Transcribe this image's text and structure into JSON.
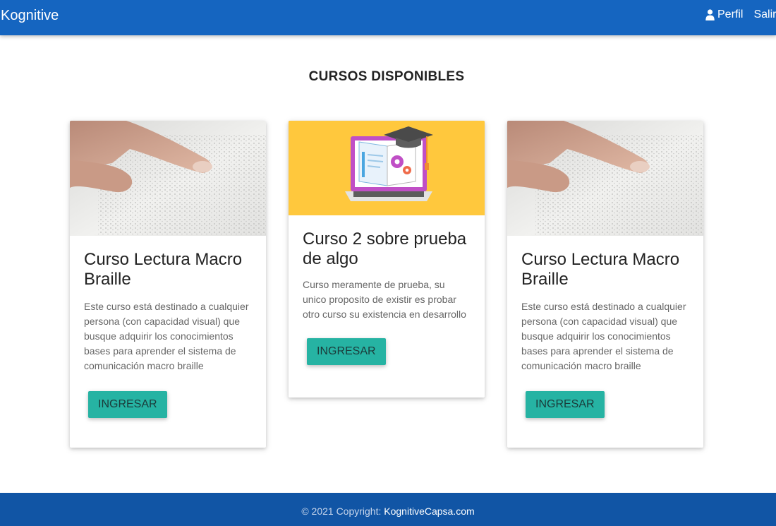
{
  "navbar": {
    "brand": "Kognitive",
    "perfil_label": "Perfil",
    "salir_label": "Salir",
    "user_icon": "user-icon"
  },
  "page": {
    "title": "CURSOS DISPONIBLES"
  },
  "courses": [
    {
      "image": "braille-reading-photo",
      "title": "Curso Lectura Macro Braille",
      "description": "Este curso está destinado a cualquier persona (con capacidad visual) que busque adquirir los conocimientos bases para aprender el sistema de comunicación macro braille",
      "button_label": "INGRESAR"
    },
    {
      "image": "laptop-book-graduation-illustration",
      "title": "Curso 2 sobre prueba de algo",
      "description": "Curso meramente de prueba, su unico proposito de existir es probar otro curso su existencia en desarrollo",
      "button_label": "INGRESAR"
    },
    {
      "image": "braille-reading-photo",
      "title": "Curso Lectura Macro Braille",
      "description": "Este curso está destinado a cualquier persona (con capacidad visual) que busque adquirir los conocimientos bases para aprender el sistema de comunicación macro braille",
      "button_label": "INGRESAR"
    }
  ],
  "footer": {
    "copyright": "© 2021 Copyright: ",
    "link_label": "KognitiveCapsa.com"
  },
  "colors": {
    "navbar": "#1565c0",
    "footer": "#1155a5",
    "button": "#26b3a3",
    "illustration_bg": "#ffc83d"
  }
}
